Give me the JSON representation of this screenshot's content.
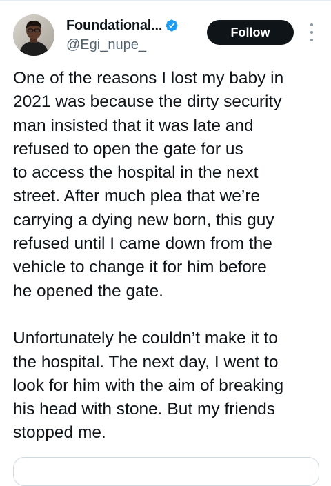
{
  "tweet": {
    "author": {
      "display_name": "Foundational...",
      "handle": "@Egi_nupe_",
      "verified": true
    },
    "follow_label": "Follow",
    "paragraphs": [
      {
        "lines": [
          "One of the reasons I lost my baby in",
          "2021 was because the dirty security",
          "man insisted that it was late and",
          "refused to open the gate for us",
          "to access the hospital in the next",
          "street. After much plea that we’re",
          "carrying a dying new born, this guy",
          "refused until I came down from the",
          "vehicle to change it for him before",
          "he opened the gate."
        ]
      },
      {
        "lines": [
          "Unfortunately he couldn’t make it to",
          "the hospital. The next day, I went to",
          "look for him with the aim of breaking",
          "his head with stone. But my friends",
          "stopped me."
        ]
      }
    ]
  },
  "colors": {
    "text": "#0f1419",
    "secondary_text": "#536471",
    "follow_bg": "#0f1419",
    "verified_badge": "#1d9bf0"
  },
  "icons": {
    "verified": "verified-badge-icon",
    "more": "more-options-icon"
  }
}
